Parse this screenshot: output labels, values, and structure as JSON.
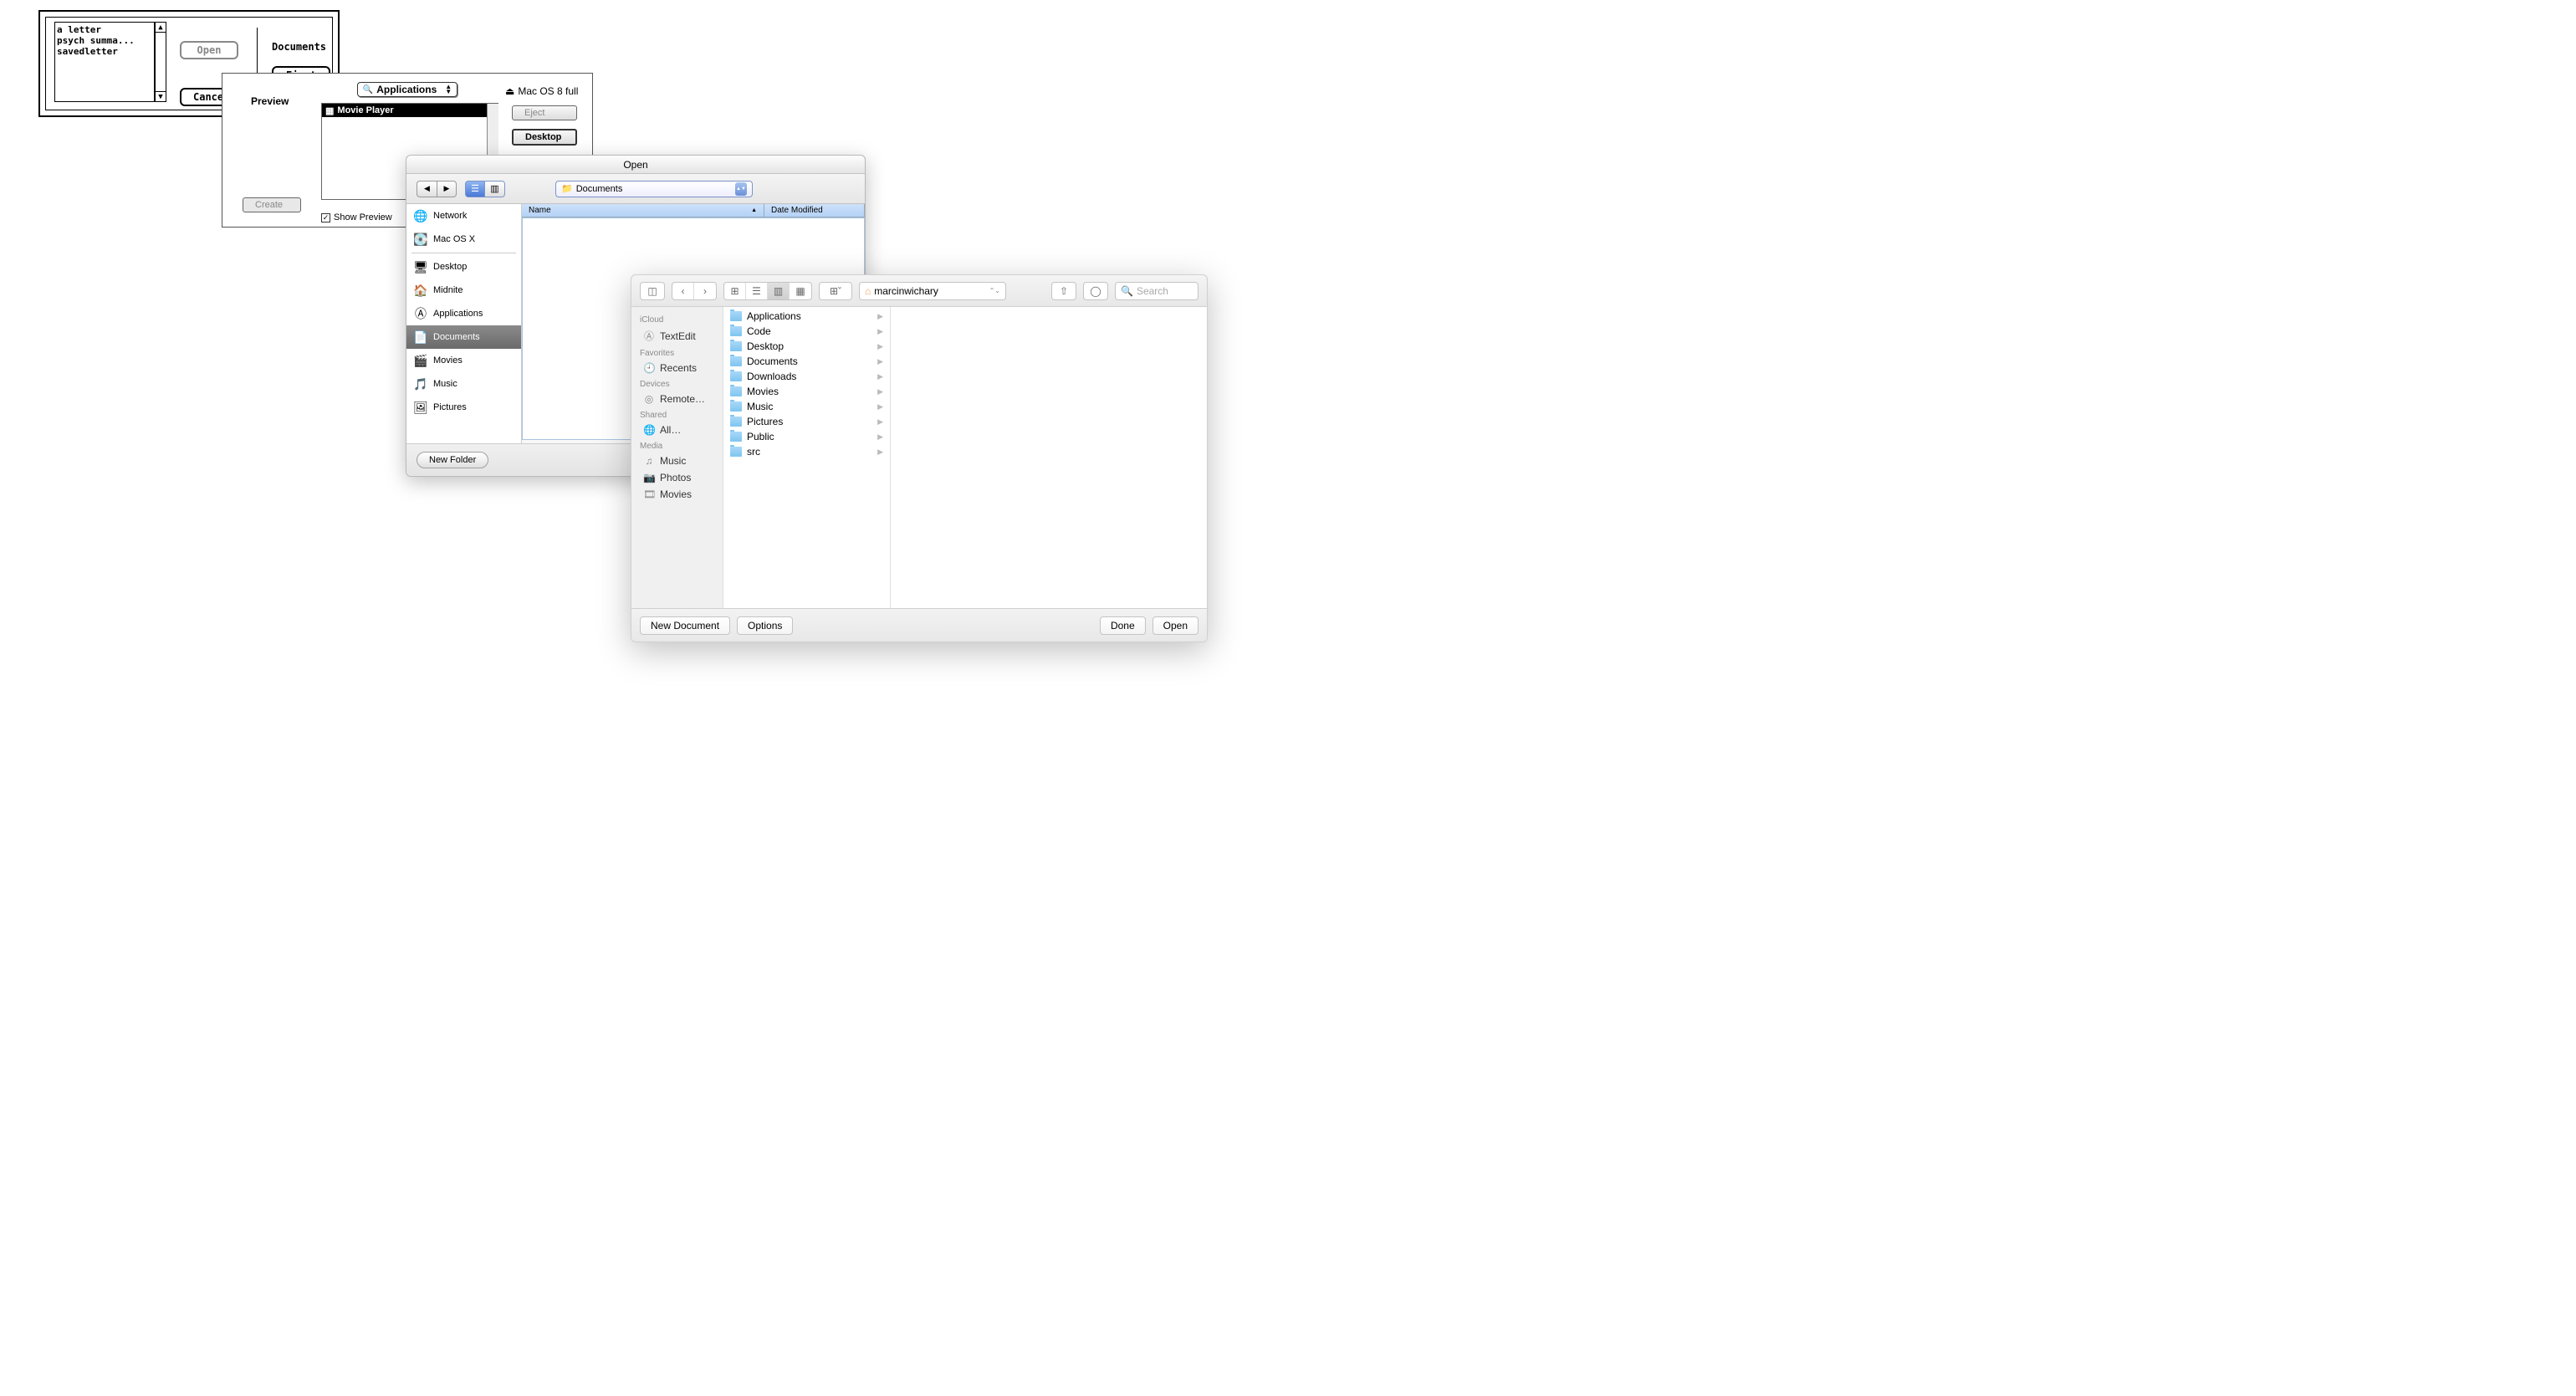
{
  "dialog1": {
    "files": [
      "a letter",
      "psych summa...",
      "savedletter"
    ],
    "open": "Open",
    "eject": "Eject",
    "cancel": "Cancel",
    "location": "Documents"
  },
  "dialog2": {
    "preview_label": "Preview",
    "popup": "Applications",
    "list_item": "Movie Player",
    "disk": "Mac OS 8 full",
    "eject": "Eject",
    "desktop": "Desktop",
    "create": "Create",
    "show_preview": "Show Preview"
  },
  "dialog3": {
    "title": "Open",
    "path": "Documents",
    "columns": {
      "name": "Name",
      "date": "Date Modified"
    },
    "sidebar_top": [
      {
        "label": "Network",
        "icon": "🌐"
      },
      {
        "label": "Mac OS X",
        "icon": "💽"
      }
    ],
    "sidebar_bottom": [
      {
        "label": "Desktop",
        "icon": "🖥"
      },
      {
        "label": "Midnite",
        "icon": "🏠"
      },
      {
        "label": "Applications",
        "icon": "Ⓐ"
      },
      {
        "label": "Documents",
        "icon": "📄",
        "selected": true
      },
      {
        "label": "Movies",
        "icon": "🎬"
      },
      {
        "label": "Music",
        "icon": "🎵"
      },
      {
        "label": "Pictures",
        "icon": "🖼"
      }
    ],
    "new_folder": "New Folder"
  },
  "dialog4": {
    "path": "marcinwichary",
    "search_placeholder": "Search",
    "sidebar": {
      "groups": [
        {
          "label": "iCloud",
          "items": [
            {
              "label": "TextEdit",
              "icon": "Ⓐ"
            }
          ]
        },
        {
          "label": "Favorites",
          "items": [
            {
              "label": "Recents",
              "icon": "🕘"
            }
          ]
        },
        {
          "label": "Devices",
          "items": [
            {
              "label": "Remote…",
              "icon": "◎"
            }
          ]
        },
        {
          "label": "Shared",
          "items": [
            {
              "label": "All…",
              "icon": "🌐"
            }
          ]
        },
        {
          "label": "Media",
          "items": [
            {
              "label": "Music",
              "icon": "♫"
            },
            {
              "label": "Photos",
              "icon": "📷"
            },
            {
              "label": "Movies",
              "icon": "🎞"
            }
          ]
        }
      ]
    },
    "folders": [
      "Applications",
      "Code",
      "Desktop",
      "Documents",
      "Downloads",
      "Movies",
      "Music",
      "Pictures",
      "Public",
      "src"
    ],
    "buttons": {
      "new_document": "New Document",
      "options": "Options",
      "done": "Done",
      "open": "Open"
    }
  }
}
